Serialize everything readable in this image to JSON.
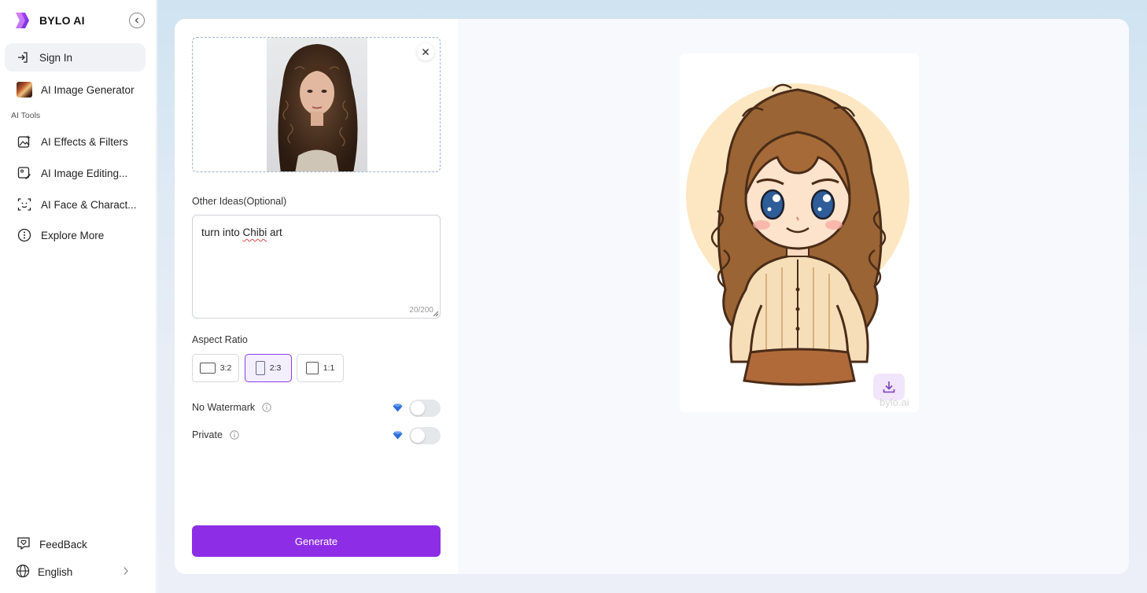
{
  "brand": {
    "name": "BYLO AI"
  },
  "sidebar": {
    "sign_in": "Sign In",
    "ai_image_generator": "AI Image Generator",
    "section_label": "AI Tools",
    "items": [
      {
        "label": "AI Effects & Filters",
        "icon": "image-sparkle-icon"
      },
      {
        "label": "AI Image Editing...",
        "icon": "image-edit-icon"
      },
      {
        "label": "AI Face & Charact...",
        "icon": "face-scan-icon"
      },
      {
        "label": "Explore More",
        "icon": "more-circle-icon"
      }
    ],
    "feedback": "FeedBack",
    "language": "English"
  },
  "form": {
    "other_ideas_label": "Other Ideas(Optional)",
    "ideas_prefix": "turn into ",
    "ideas_misspelled": "Chibi",
    "ideas_suffix": " art",
    "counter": "20/200",
    "aspect_ratio_label": "Aspect Ratio",
    "ratios": [
      "3:2",
      "2:3",
      "1:1"
    ],
    "selected_ratio": "2:3",
    "no_watermark_label": "No Watermark",
    "private_label": "Private",
    "no_watermark_on": false,
    "private_on": false,
    "generate_label": "Generate"
  },
  "result": {
    "watermark": "bylo.ai"
  },
  "colors": {
    "accent": "#8d2ee6",
    "accent_light": "#f3efff"
  }
}
